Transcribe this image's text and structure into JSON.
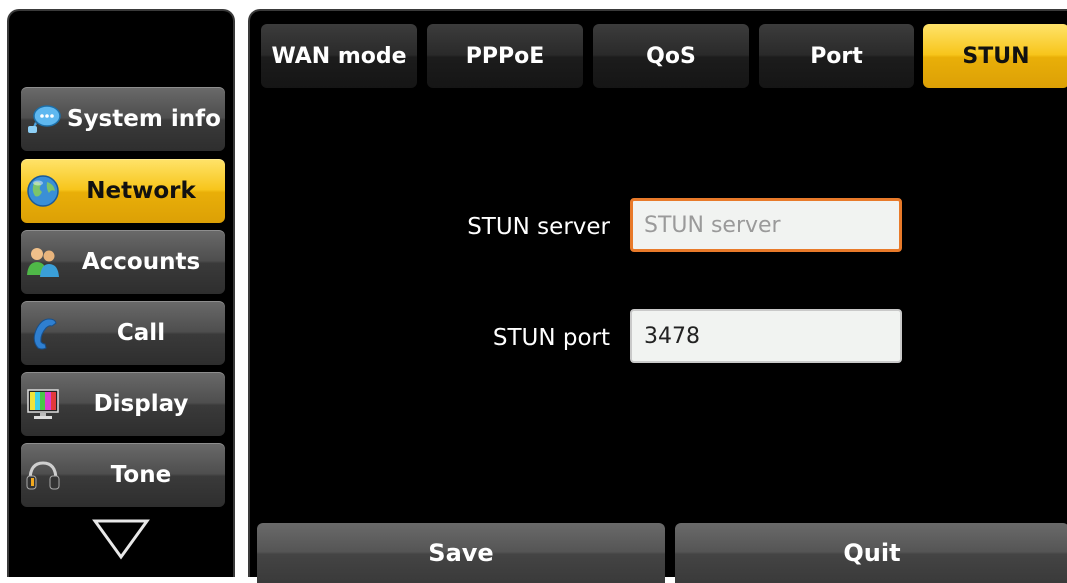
{
  "sidebar": {
    "items": [
      {
        "label": "System info",
        "icon": "chat-bubble-icon",
        "active": false
      },
      {
        "label": "Network",
        "icon": "globe-icon",
        "active": true
      },
      {
        "label": "Accounts",
        "icon": "users-icon",
        "active": false
      },
      {
        "label": "Call",
        "icon": "phone-handset-icon",
        "active": false
      },
      {
        "label": "Display",
        "icon": "monitor-icon",
        "active": false
      },
      {
        "label": "Tone",
        "icon": "headphones-icon",
        "active": false
      }
    ],
    "more_icon": "triangle-down-icon"
  },
  "tabs": [
    {
      "label": "WAN mode",
      "active": false
    },
    {
      "label": "PPPoE",
      "active": false
    },
    {
      "label": "QoS",
      "active": false
    },
    {
      "label": "Port",
      "active": false
    },
    {
      "label": "STUN",
      "active": true
    }
  ],
  "form": {
    "stun_server": {
      "label": "STUN server",
      "value": "",
      "placeholder": "STUN server"
    },
    "stun_port": {
      "label": "STUN port",
      "value": "3478"
    }
  },
  "actions": {
    "save_label": "Save",
    "quit_label": "Quit"
  },
  "colors": {
    "accent": "#f7c51b",
    "focus_border": "#e87a2a",
    "background": "#000000"
  }
}
